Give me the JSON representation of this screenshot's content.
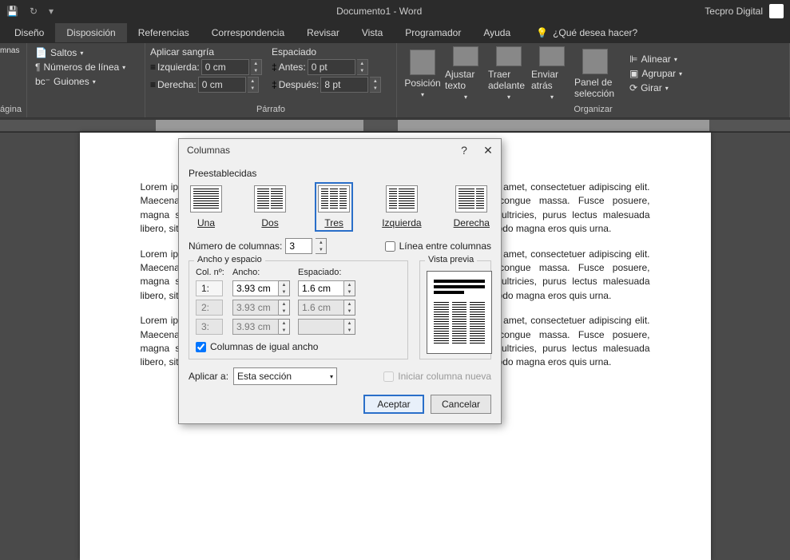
{
  "title": "Documento1 - Word",
  "profile": "Tecpro Digital",
  "tabs": [
    "Diseño",
    "Disposición",
    "Referencias",
    "Correspondencia",
    "Revisar",
    "Vista",
    "Programador",
    "Ayuda"
  ],
  "activeTab": 1,
  "tellMe": "¿Qué desea hacer?",
  "ribbon": {
    "pageSetup": {
      "breaks": "Saltos",
      "lineNumbers": "Números de línea",
      "hyphenation": "Guiones",
      "groupExtras": "gina",
      "columns": "mnas"
    },
    "pageSetupTitle": "ágina",
    "paragraph": {
      "title": "Párrafo",
      "indentTitle": "Aplicar sangría",
      "spacingTitle": "Espaciado",
      "left": "Izquierda:",
      "right": "Derecha:",
      "before": "Antes:",
      "after": "Después:",
      "leftVal": "0 cm",
      "rightVal": "0 cm",
      "beforeVal": "0 pt",
      "afterVal": "8 pt"
    },
    "arrange": {
      "title": "Organizar",
      "position": "Posición",
      "wrap": "Ajustar texto",
      "forward": "Traer adelante",
      "backward": "Enviar atrás",
      "pane": "Panel de selección",
      "align": "Alinear",
      "group": "Agrupar",
      "rotate": "Girar"
    }
  },
  "document": {
    "para1": "Lorem ipsum dolor sit amet, consectetuer adipiscing elit. Maecenas porttitor congue massa. Fusce posuere, magna sed pulvinar ultricies, purus lectus malesuada libero, sit amet commodo magna eros quis urna.",
    "para2": "Lorem ipsum dolor sit amet, consectetuer adipiscing elit. Maecenas porttitor congue massa. Fusce posuere, magna sed pulvinar ultricies, purus lectus malesuada libero, sit amet commodo magna eros quis urna.",
    "para3": "Lorem ipsum dolor sit amet, consectetuer adipiscing elit. Maecenas porttitor congue massa. Fusce posuere, magna sed pulvinar ultricies, purus lectus malesuada libero, sit amet commodo magna eros quis urna."
  },
  "dialog": {
    "title": "Columnas",
    "presetsTitle": "Preestablecidas",
    "presets": {
      "one": "Una",
      "two": "Dos",
      "three": "Tres",
      "left": "Izquierda",
      "right": "Derecha"
    },
    "numColsLabel": "Número de columnas:",
    "numCols": "3",
    "lineBetween": "Línea entre columnas",
    "widthGroup": "Ancho y espacio",
    "previewGroup": "Vista previa",
    "colNum": "Col. nº:",
    "width": "Ancho:",
    "spacing": "Espaciado:",
    "rows": [
      {
        "n": "1:",
        "w": "3.93 cm",
        "s": "1.6 cm"
      },
      {
        "n": "2:",
        "w": "3.93 cm",
        "s": "1.6 cm"
      },
      {
        "n": "3:",
        "w": "3.93 cm",
        "s": ""
      }
    ],
    "equalWidth": "Columnas de igual ancho",
    "applyTo": "Aplicar a:",
    "applySel": "Esta sección",
    "newCol": "Iniciar columna nueva",
    "ok": "Aceptar",
    "cancel": "Cancelar"
  }
}
